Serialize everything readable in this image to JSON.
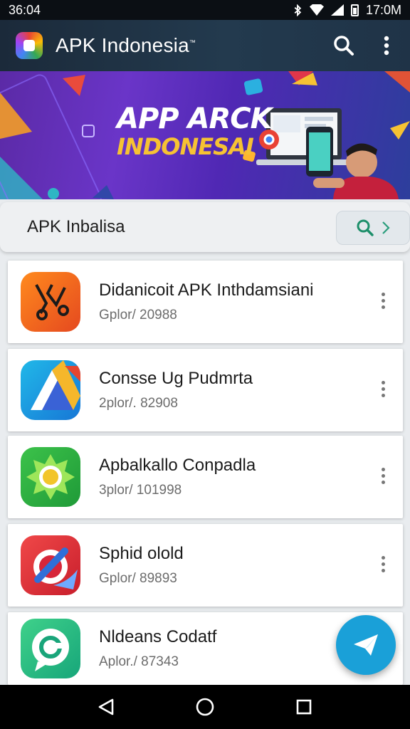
{
  "status": {
    "time_left": "36:04",
    "time_right": "17:0M"
  },
  "app_bar": {
    "title": "APK Indonesia",
    "trademark": "™"
  },
  "banner": {
    "line1": "APP ARCK",
    "line2": "INDONESAI"
  },
  "search": {
    "text": "APK Inbalisa"
  },
  "apps": [
    {
      "name": "Didanicoit  APK Inthdamsiani",
      "meta": "Gplor/ 20988",
      "icon": "pliers-tool-icon"
    },
    {
      "name": "Consse Ug Pudmrta",
      "meta": "2plor/. 82908",
      "icon": "arrow-triangle-icon"
    },
    {
      "name": "Apbalkallo Conpadla",
      "meta": "3plor/ 101998",
      "icon": "sun-badge-icon"
    },
    {
      "name": "Sphid olold",
      "meta": "Gplor/ 89893",
      "icon": "pen-target-icon"
    },
    {
      "name": "Nldeans Codatf",
      "meta": "Aplor./ 87343",
      "icon": "chat-bubble-icon"
    }
  ],
  "colors": {
    "app_bar": "#1f3347",
    "banner": "#5b2aa6",
    "fab": "#1aa0d8",
    "accent_yellow": "#f6c233"
  }
}
